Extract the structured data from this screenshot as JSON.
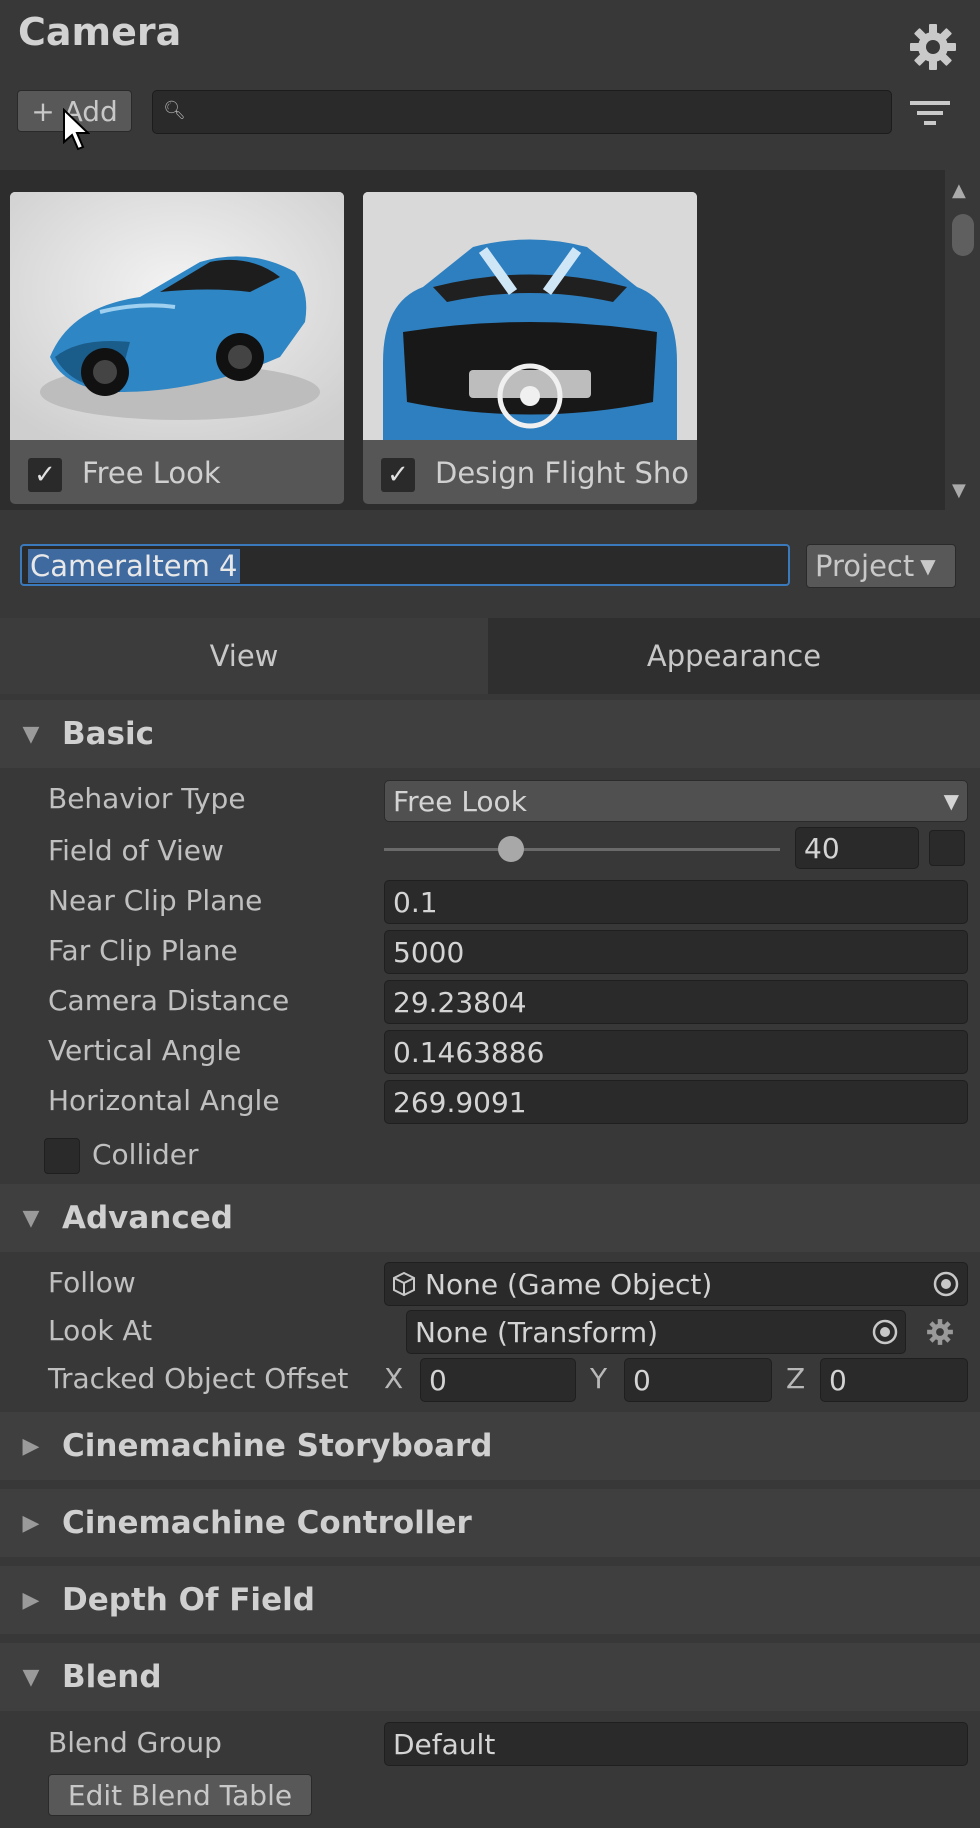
{
  "header": {
    "title": "Camera",
    "add_label": "+ Add",
    "search_placeholder": ""
  },
  "gallery": {
    "cards": [
      {
        "label": "Free Look",
        "checked": true
      },
      {
        "label": "Design Flight Sho",
        "checked": true
      }
    ]
  },
  "item": {
    "name": "CameraItem 4",
    "scope": "Project"
  },
  "tabs": [
    {
      "label": "View"
    },
    {
      "label": "Appearance"
    }
  ],
  "basic": {
    "title": "Basic",
    "behavior_type": {
      "label": "Behavior Type",
      "value": "Free Look"
    },
    "fov": {
      "label": "Field of View",
      "value": "40",
      "slider_fraction": 0.32
    },
    "near": {
      "label": "Near Clip Plane",
      "value": "0.1"
    },
    "far": {
      "label": "Far Clip Plane",
      "value": "5000"
    },
    "distance": {
      "label": "Camera Distance",
      "value": "29.23804"
    },
    "vertical": {
      "label": "Vertical Angle",
      "value": "0.1463886"
    },
    "horizontal": {
      "label": "Horizontal Angle",
      "value": "269.9091"
    },
    "collider": {
      "label": "Collider",
      "checked": false
    }
  },
  "advanced": {
    "title": "Advanced",
    "follow": {
      "label": "Follow",
      "value": "None (Game Object)"
    },
    "look_at": {
      "label": "Look At",
      "value": "None (Transform)"
    },
    "offset": {
      "label": "Tracked Object Offset",
      "x_label": "X",
      "x": "0",
      "y_label": "Y",
      "y": "0",
      "z_label": "Z",
      "z": "0"
    }
  },
  "collapsed_sections": [
    {
      "title": "Cinemachine Storyboard"
    },
    {
      "title": "Cinemachine Controller"
    },
    {
      "title": "Depth Of Field"
    }
  ],
  "blend": {
    "title": "Blend",
    "group": {
      "label": "Blend Group",
      "value": "Default"
    },
    "edit_label": "Edit Blend Table"
  },
  "colors": {
    "accent": "#3a79bb",
    "background": "#383838",
    "field": "#2a2a2a"
  }
}
